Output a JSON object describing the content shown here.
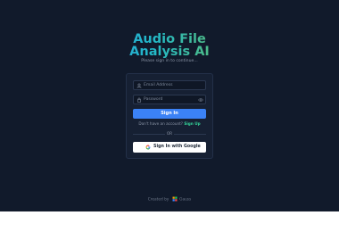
{
  "app": {
    "title_line1": "Audio File",
    "title_line2": "Analysis AI",
    "subtitle": "Please sign in to continue..."
  },
  "form": {
    "email_placeholder": "Email Address",
    "password_placeholder": "Password",
    "signin_label": "Sign In",
    "signup_prompt": "Don't have an account?",
    "signup_link": "Sign Up",
    "divider_label": "OR",
    "google_label": "Sign In with Google"
  },
  "icons": {
    "email": "user-icon",
    "password": "lock-icon",
    "visibility": "eye-icon",
    "google": "google-icon",
    "footer_logo": "logo-icon"
  },
  "footer": {
    "prefix": "Created by",
    "brand": "Gauss"
  },
  "colors": {
    "background": "#111a2b",
    "card": "#162033",
    "primary": "#3b82f6",
    "link": "#34d399"
  }
}
